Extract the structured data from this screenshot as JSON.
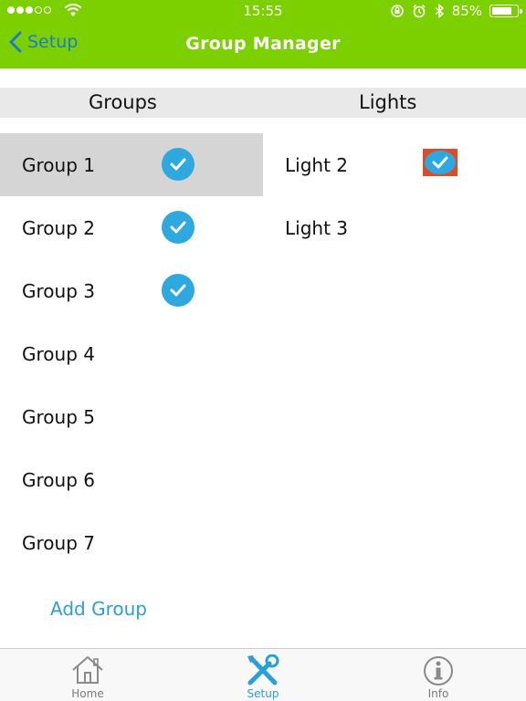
{
  "status_bar": {
    "time": "15:55",
    "battery_percent": "85%",
    "battery_level": 0.85,
    "signal_dots_filled": 3,
    "signal_dots_total": 5
  },
  "nav": {
    "back_label": "Setup",
    "title": "Group Manager"
  },
  "columns": {
    "groups_header": "Groups",
    "lights_header": "Lights"
  },
  "groups": [
    {
      "label": "Group 1",
      "checked": true,
      "selected": true
    },
    {
      "label": "Group 2",
      "checked": true,
      "selected": false
    },
    {
      "label": "Group 3",
      "checked": true,
      "selected": false
    },
    {
      "label": "Group 4",
      "checked": false,
      "selected": false
    },
    {
      "label": "Group 5",
      "checked": false,
      "selected": false
    },
    {
      "label": "Group 6",
      "checked": false,
      "selected": false
    },
    {
      "label": "Group 7",
      "checked": false,
      "selected": false
    }
  ],
  "lights": [
    {
      "label": "Light 2",
      "checked": true
    },
    {
      "label": "Light 3",
      "checked": false
    }
  ],
  "add_group_label": "Add Group",
  "tabs": [
    {
      "label": "Home",
      "icon": "house-icon",
      "active": false
    },
    {
      "label": "Setup",
      "icon": "tools-icon",
      "active": true
    },
    {
      "label": "Info",
      "icon": "info-icon",
      "active": false
    }
  ],
  "colors": {
    "header_green": "#7dd000",
    "check_blue": "#2fa8df",
    "link_blue": "#2a9fd6",
    "selected_row": "#d5d5d5",
    "highlight_orange": "#e24a22"
  }
}
